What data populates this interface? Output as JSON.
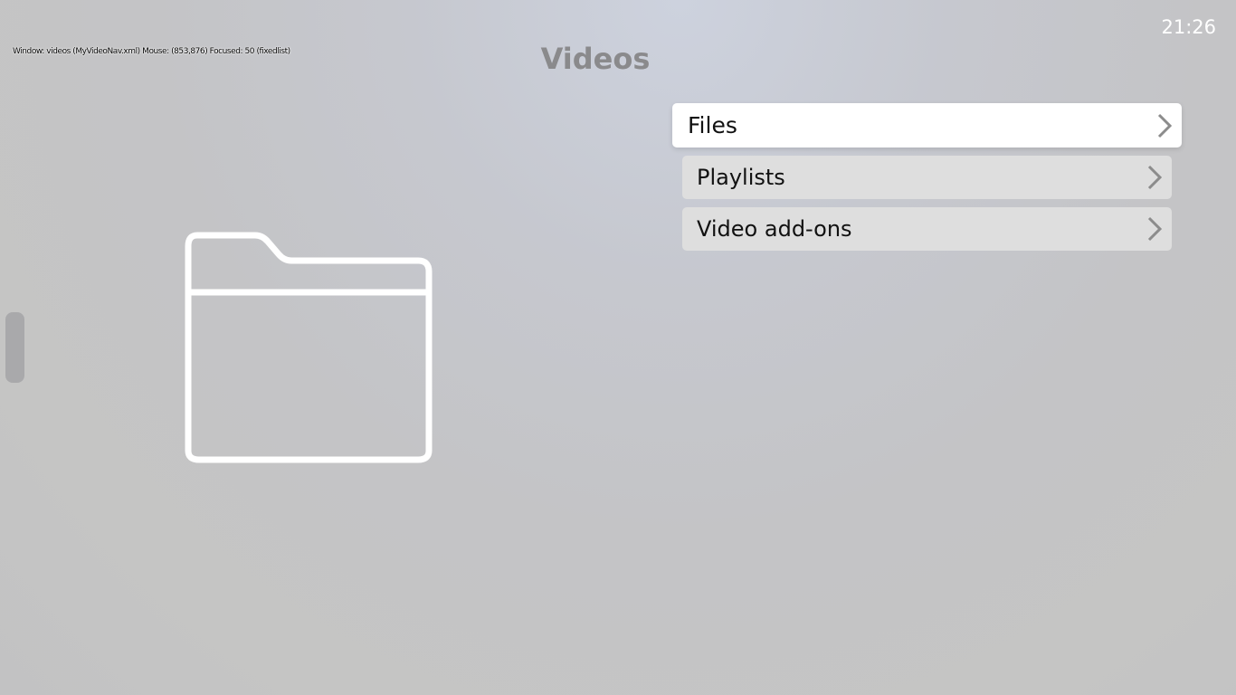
{
  "debug": {
    "text": "Window: videos (MyVideoNav.xml)  Mouse: (853,876)  Focused: 50 (fixedlist)"
  },
  "header": {
    "title": "Videos",
    "clock": "21:26"
  },
  "menu": {
    "items": [
      {
        "label": "Files",
        "focused": true,
        "icon": "chevron-right-icon"
      },
      {
        "label": "Playlists",
        "focused": false,
        "icon": "chevron-right-icon"
      },
      {
        "label": "Video add-ons",
        "focused": false,
        "icon": "chevron-right-icon"
      }
    ]
  },
  "preview": {
    "icon": "folder-icon"
  },
  "colors": {
    "title": "#8a8a8c",
    "focused_item_bg": "#ffffff",
    "item_bg": "#dedede",
    "chevron": "#8c8c8c"
  }
}
